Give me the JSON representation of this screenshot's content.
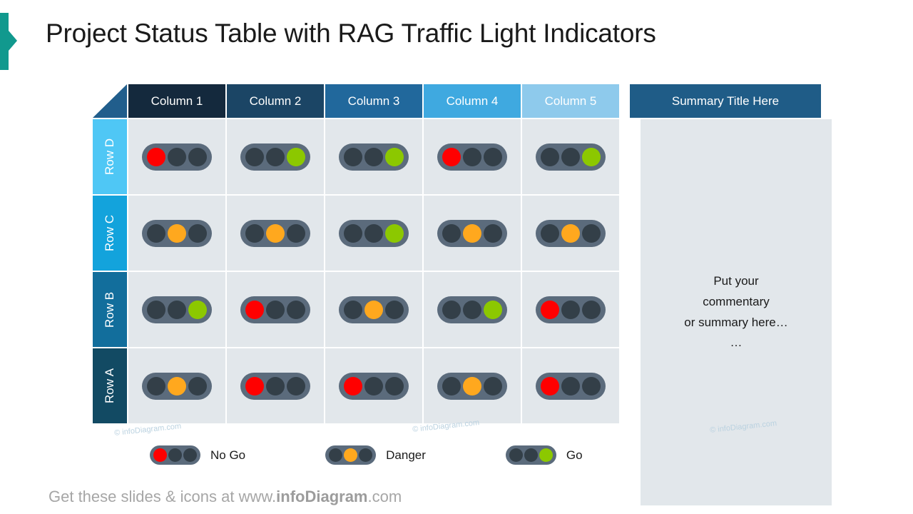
{
  "title": "Project Status Table with RAG Traffic Light Indicators",
  "accent": {
    "bar_color": "#11998e"
  },
  "table": {
    "corner_color": "#215E8C",
    "columns": [
      {
        "label": "Column 1",
        "color": "#14293D"
      },
      {
        "label": "Column 2",
        "color": "#1B4565"
      },
      {
        "label": "Column 3",
        "color": "#21689C"
      },
      {
        "label": "Column 4",
        "color": "#3FA9E0"
      },
      {
        "label": "Column 5",
        "color": "#8ECAEC"
      }
    ],
    "rows": [
      {
        "label": "Row D",
        "color": "#4FC7F5",
        "cells": [
          "red",
          "green",
          "green",
          "red",
          "green"
        ]
      },
      {
        "label": "Row C",
        "color": "#13A3DC",
        "cells": [
          "amber",
          "amber",
          "green",
          "amber",
          "amber"
        ]
      },
      {
        "label": "Row B",
        "color": "#126E9C",
        "cells": [
          "green",
          "red",
          "amber",
          "green",
          "red"
        ]
      },
      {
        "label": "Row A",
        "color": "#124A63",
        "cells": [
          "amber",
          "red",
          "red",
          "amber",
          "red"
        ]
      }
    ],
    "cell_bg": "#E2E7EB"
  },
  "summary": {
    "title": "Summary Title Here",
    "title_color": "#1F5C87",
    "body": "Put your\ncommentary\nor summary here…\n…"
  },
  "traffic_light": {
    "body_color": "#5B6B7C",
    "off_color": "#333F48",
    "red": "#FF0000",
    "amber": "#FFA81E",
    "green": "#8CC800"
  },
  "legend": [
    {
      "state": "red",
      "label": "No Go"
    },
    {
      "state": "amber",
      "label": "Danger"
    },
    {
      "state": "green",
      "label": "Go"
    }
  ],
  "watermark": "© infoDiagram.com",
  "footer": {
    "prefix": "Get these slides & icons at www.",
    "brand": "infoDiagram",
    "suffix": ".com"
  }
}
